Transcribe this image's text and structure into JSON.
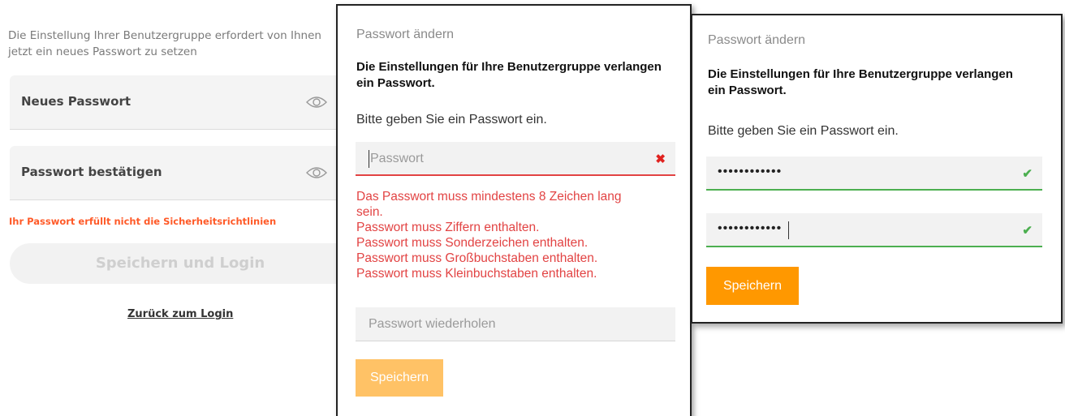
{
  "panel1": {
    "intro": "Die Einstellung Ihrer Benutzergruppe erfordert von Ihnen jetzt ein neues Passwort zu setzen",
    "new_password_label": "Neues Passwort",
    "confirm_password_label": "Passwort bestätigen",
    "error": "Ihr Passwort erfüllt nicht die Sicherheitsrichtlinien",
    "save_login_button": "Speichern und Login",
    "back_link": "Zurück zum Login"
  },
  "panel2": {
    "title": "Passwort ändern",
    "requirement": "Die Einstellungen für Ihre Benutzergruppe verlangen ein Passwort.",
    "instruction": "Bitte geben Sie ein Passwort ein.",
    "password_placeholder": "Passwort",
    "errors": [
      "Das Passwort muss mindestens 8 Zeichen lang",
      "sein.",
      "Passwort muss Ziffern enthalten.",
      "Passwort muss Sonderzeichen enthalten.",
      "Passwort muss Großbuchstaben enthalten.",
      "Passwort muss Kleinbuchstaben enthalten."
    ],
    "repeat_placeholder": "Passwort wiederholen",
    "save_button": "Speichern"
  },
  "panel3": {
    "title": "Passwort ändern",
    "requirement": "Die Einstellungen für Ihre Benutzergruppe verlangen ein Passwort.",
    "instruction": "Bitte geben Sie ein Passwort ein.",
    "password_value": "••••••••••••",
    "repeat_value": "••••••••••••",
    "save_button": "Speichern"
  },
  "icons": {
    "eye": "eye-icon",
    "invalid": "cross-icon",
    "valid": "check-icon"
  },
  "colors": {
    "error_red": "#e24343",
    "warning_orange": "#ff5a28",
    "valid_green": "#4caf50",
    "button_orange": "#ff9800",
    "button_orange_disabled": "#ffc266"
  }
}
